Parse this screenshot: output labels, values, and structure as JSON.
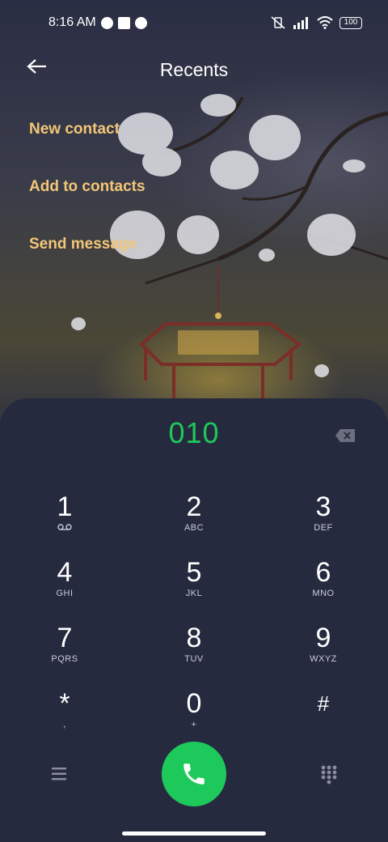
{
  "status_bar": {
    "time": "8:16 AM",
    "battery": "100",
    "icons": [
      "notification-icon",
      "square-icon",
      "notification-icon",
      "vibrate-off-icon",
      "signal-icon",
      "wifi-icon",
      "battery-icon"
    ]
  },
  "header": {
    "title": "Recents",
    "back_icon": "back-arrow-icon"
  },
  "actions": [
    {
      "label": "New contact"
    },
    {
      "label": "Add to contacts"
    },
    {
      "label": "Send message"
    }
  ],
  "dialer": {
    "number": "010",
    "keys": [
      {
        "digit": "1",
        "sub": ""
      },
      {
        "digit": "2",
        "sub": "ABC"
      },
      {
        "digit": "3",
        "sub": "DEF"
      },
      {
        "digit": "4",
        "sub": "GHI"
      },
      {
        "digit": "5",
        "sub": "JKL"
      },
      {
        "digit": "6",
        "sub": "MNO"
      },
      {
        "digit": "7",
        "sub": "PQRS"
      },
      {
        "digit": "8",
        "sub": "TUV"
      },
      {
        "digit": "9",
        "sub": "WXYZ"
      },
      {
        "digit": "*",
        "sub": ","
      },
      {
        "digit": "0",
        "sub": "+"
      },
      {
        "digit": "#",
        "sub": ""
      }
    ]
  },
  "colors": {
    "accent": "#1ec95b",
    "link": "#f3c677",
    "background": "#262a3f"
  }
}
